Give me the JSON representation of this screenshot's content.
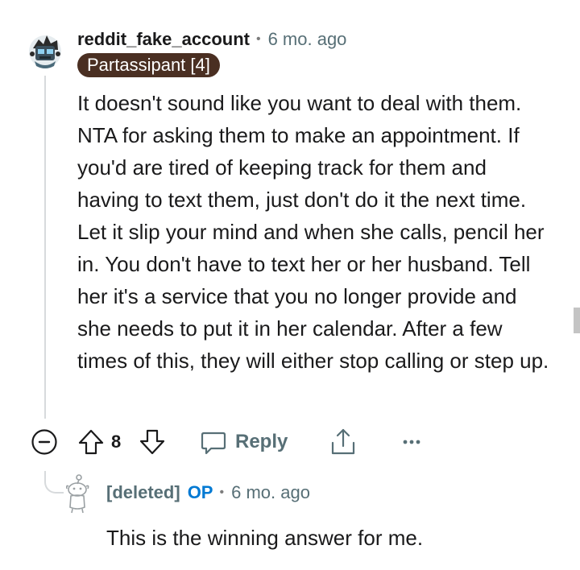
{
  "comment": {
    "username": "reddit_fake_account",
    "separator": "•",
    "time": "6 mo. ago",
    "flair": "Partassipant [4]",
    "body": "It doesn't sound like you want to deal with them. NTA for asking them to make an appointment. If you'd are tired of keeping track for them and having to text them, just don't do it the next time. Let it slip your mind and when she calls, pencil her in. You don't have to text her or her husband. Tell her it's a service that you no longer provide and she needs to put it in her calendar. After a few times of this, they will either stop calling or step up.",
    "score": "8",
    "reply_label": "Reply",
    "more_label": "•••"
  },
  "reply": {
    "username": "[deleted]",
    "op_badge": "OP",
    "separator": "•",
    "time": "6 mo. ago",
    "body": "This is the winning answer for me."
  },
  "icons": {
    "avatar": "robot-avatar-icon",
    "collapse": "minus-circle-icon",
    "upvote": "arrow-up-icon",
    "downvote": "arrow-down-icon",
    "reply": "speech-bubble-icon",
    "share": "share-icon",
    "more": "ellipsis-icon",
    "deleted_avatar": "snoo-sketch-icon"
  },
  "colors": {
    "flair_bg": "#4a2f22",
    "op": "#0079d3",
    "meta": "#576f76"
  }
}
